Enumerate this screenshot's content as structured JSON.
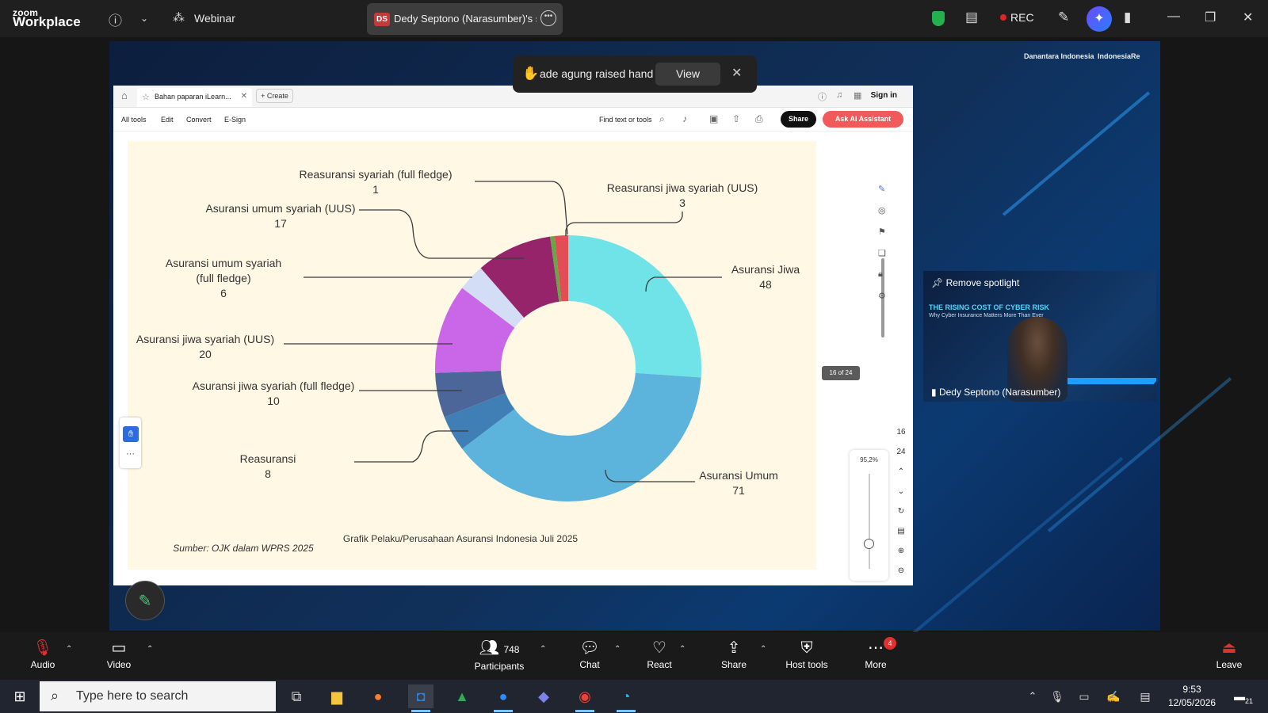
{
  "zoom": {
    "logo_line1": "zoom",
    "logo_line2": "Workplace",
    "webinar_label": "Webinar",
    "share_tab_initials": "DS",
    "share_tab_title": "Dedy Septono (Narasumber)'s scr",
    "rec_label": "REC",
    "raised_hand_text": "ade agung raised hand",
    "raised_hand_view": "View",
    "spotlight_label": "Remove spotlight",
    "video_title": "THE RISING COST OF CYBER RISK",
    "video_subtitle": "Why Cyber Insurance Matters More Than Ever",
    "video_name": "Dedy Septono (Narasumber)",
    "slide_brands": [
      "Danantara Indonesia",
      "IndonesiaRe"
    ]
  },
  "acrobat": {
    "tab_title": "Bahan paparan iLearn...",
    "create_label": "Create",
    "sign_in": "Sign in",
    "menu": [
      "All tools",
      "Edit",
      "Convert",
      "E-Sign"
    ],
    "find_label": "Find text or tools",
    "share_label": "Share",
    "ai_label": "Ask AI Assistant",
    "page_indicator": "16 of 24",
    "zoom_level": "95,2%",
    "page_current": "16",
    "page_total": "24"
  },
  "chart_data": {
    "type": "pie",
    "title": "Grafik Pelaku/Perusahaan Asuransi Indonesia Juli 2025",
    "source": "Sumber: OJK dalam WPRS 2025",
    "series": [
      {
        "name": "Asuransi Jiwa",
        "value": 48,
        "color": "#6fe3e8"
      },
      {
        "name": "Asuransi Umum",
        "value": 71,
        "color": "#5cb3dc"
      },
      {
        "name": "Reasuransi",
        "value": 8,
        "color": "#3f7fb5"
      },
      {
        "name": "Asuransi jiwa syariah (full fledge)",
        "value": 10,
        "color": "#4d6699"
      },
      {
        "name": "Asuransi jiwa syariah (UUS)",
        "value": 20,
        "color": "#c967e8"
      },
      {
        "name": "Asuransi umum syariah (full fledge)",
        "value": 6,
        "color": "#d3def6"
      },
      {
        "name": "Asuransi umum syariah (UUS)",
        "value": 17,
        "color": "#96246a"
      },
      {
        "name": "Reasuransi syariah (full fledge)",
        "value": 1,
        "color": "#62a846"
      },
      {
        "name": "Reasuransi jiwa syariah (UUS)",
        "value": 3,
        "color": "#e24d56"
      }
    ],
    "labels": {
      "jiwa": {
        "name": "Asuransi Jiwa",
        "value": "48"
      },
      "umum": {
        "name": "Asuransi Umum",
        "value": "71"
      },
      "reas": {
        "name": "Reasuransi",
        "value": "8"
      },
      "jsff": {
        "name": "Asuransi jiwa syariah  (full fledge)",
        "value": "10"
      },
      "jsuus": {
        "name": "Asuransi jiwa syariah  (UUS)",
        "value": "20"
      },
      "usff1": "Asuransi umum syariah",
      "usff2": "(full fledge)",
      "usff": {
        "value": "6"
      },
      "usuus": {
        "name": "Asuransi umum syariah (UUS)",
        "value": "17"
      },
      "rsff": {
        "name": "Reasuransi syariah (full fledge)",
        "value": "1"
      },
      "rjs": {
        "name": "Reasuransi jiwa syariah (UUS)",
        "value": "3"
      }
    }
  },
  "bottom": {
    "audio": "Audio",
    "video": "Video",
    "participants": "Participants",
    "participant_count": "748",
    "chat": "Chat",
    "react": "React",
    "share": "Share",
    "host_tools": "Host tools",
    "more": "More",
    "more_badge": "4",
    "leave": "Leave"
  },
  "taskbar": {
    "search_placeholder": "Type here to search",
    "time": "9:53",
    "date": "12/05/2026",
    "notif_count": "21"
  }
}
